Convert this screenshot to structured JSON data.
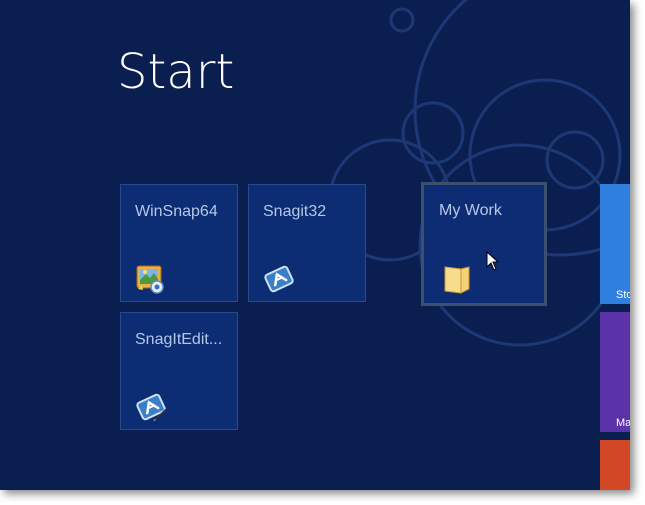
{
  "screen": {
    "title": "Start"
  },
  "tiles": [
    {
      "label": "WinSnap64",
      "icon": "winsnap-app-icon"
    },
    {
      "label": "Snagit32",
      "icon": "snagit-app-icon"
    },
    {
      "label": "My Work",
      "icon": "folder-icon",
      "selected": true
    },
    {
      "label": "SnagItEdit...",
      "icon": "snagit-editor-icon"
    }
  ],
  "side_tiles": [
    {
      "label": "Sto",
      "color": "#2f7fe0"
    },
    {
      "label": "Ma",
      "color": "#5b32a8"
    },
    {
      "label": "",
      "color": "#d24726"
    }
  ],
  "colors": {
    "background": "#0a1f4f",
    "tile": "#0c2c73",
    "tile_text": "#b7c8e6"
  }
}
